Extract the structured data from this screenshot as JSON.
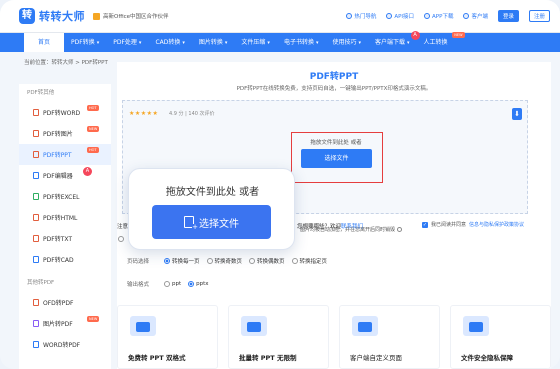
{
  "header": {
    "logo_mark": "转",
    "logo_text": "转转大师",
    "partner": "高新Office中国区合作伙伴",
    "links": [
      {
        "label": "热门导航",
        "icon": "fire-icon"
      },
      {
        "label": "API接口",
        "icon": "api-icon"
      },
      {
        "label": "APP下载",
        "icon": "phone-icon"
      },
      {
        "label": "客户端",
        "icon": "download-icon"
      }
    ],
    "login": "登录",
    "register": "注册"
  },
  "nav": {
    "items": [
      {
        "label": "首页",
        "active": true
      },
      {
        "label": "PDF转换",
        "caret": "▾"
      },
      {
        "label": "PDF处理",
        "caret": "▾"
      },
      {
        "label": "CAD转换",
        "caret": "▾"
      },
      {
        "label": "图片转换",
        "caret": "▾"
      },
      {
        "label": "文件压缩",
        "caret": "▾"
      },
      {
        "label": "电子书转换",
        "caret": "▾"
      },
      {
        "label": "使用技巧",
        "caret": "▾"
      },
      {
        "label": "客户端下载",
        "caret": "▾",
        "badge": "A"
      },
      {
        "label": "人工转换",
        "tag": "NEW"
      }
    ]
  },
  "breadcrumb": "当前位置：转转大师 > PDF转PPT",
  "sidebar": {
    "section1": "PDF转其他",
    "items1": [
      {
        "label": "PDF转WORD",
        "tag": "HOT",
        "color": "red"
      },
      {
        "label": "PDF转图片",
        "tag": "NEW",
        "color": "red"
      },
      {
        "label": "PDF转PPT",
        "tag": "HOT",
        "active": true,
        "color": "red"
      },
      {
        "label": "PDF编辑器",
        "badge": "A",
        "color": "blue"
      },
      {
        "label": "PDF转EXCEL",
        "color": "green"
      },
      {
        "label": "PDF转HTML",
        "color": "red"
      },
      {
        "label": "PDF转TXT",
        "color": "red"
      },
      {
        "label": "PDF转CAD",
        "color": "blue"
      }
    ],
    "section2": "其他转PDF",
    "items2": [
      {
        "label": "OFD转PDF",
        "color": "red"
      },
      {
        "label": "图片转PDF",
        "tag": "NEW",
        "color": "purple"
      },
      {
        "label": "WORD转PDF",
        "color": "blue"
      }
    ]
  },
  "main": {
    "title": "PDF转PPT",
    "subtitle": "PDF转PPT在线转换免费，支持页码自选，一键输出PPT/PPTX印格式演示文稿。",
    "stars": "★★★★★",
    "rating": "4.9 分 | 140 次评价",
    "drop_hint": "拖放文件到此处 或者",
    "select_label": "选择文件",
    "tip": "图片均被自动加密，并在您离开后同时销毁"
  },
  "options": {
    "note_left": "注意",
    "note_mid": "您想要哪些？欢迎",
    "note_link": "联系我们",
    "agree_prefix": "我已阅读并同意",
    "agree_link": "信息与隐私保护政策协议",
    "pages_label": "页码选择",
    "pages": [
      {
        "label": "转换每一页",
        "selected": true
      },
      {
        "label": "转换奇数页",
        "selected": false
      },
      {
        "label": "转换偶数页",
        "selected": false
      },
      {
        "label": "转换指定页",
        "selected": false
      }
    ],
    "format_label": "输出格式",
    "formats": [
      {
        "label": "ppt",
        "selected": false
      },
      {
        "label": "pptx",
        "selected": true
      }
    ]
  },
  "cards": [
    {
      "title": "免费转 PPT 双格式",
      "icon": "ppt-icon"
    },
    {
      "title": "批量转 PPT 无限制",
      "icon": "batch-icon"
    },
    {
      "title": "客户端自定义页面",
      "icon": "desktop-icon"
    },
    {
      "title": "文件安全隐私保障",
      "icon": "shield-icon"
    }
  ],
  "popup": {
    "text": "拖放文件到此处 或者",
    "button": "选择文件"
  },
  "colors": {
    "primary": "#2e7bf5",
    "highlight_border": "#e53e3e",
    "hot": "#ff6a4d"
  }
}
